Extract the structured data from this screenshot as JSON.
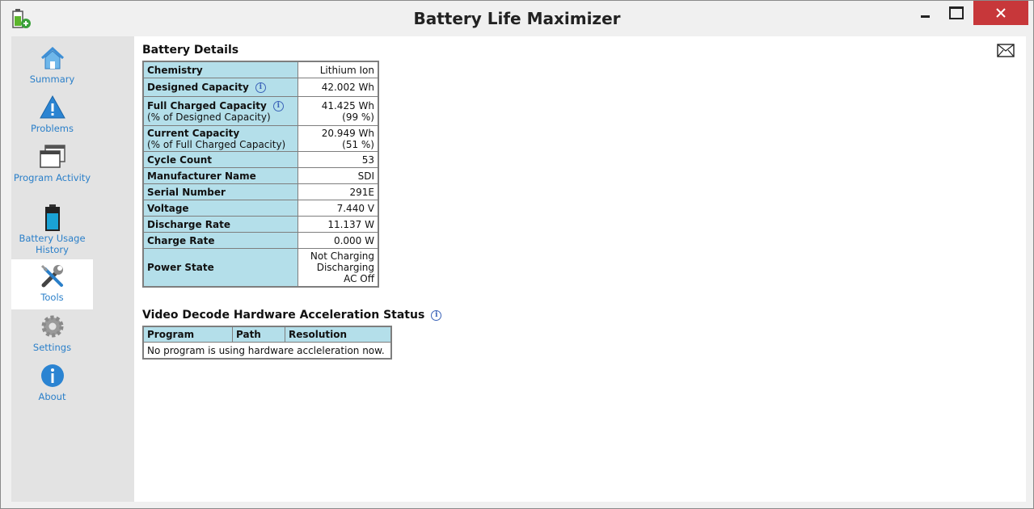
{
  "window": {
    "title": "Battery Life Maximizer"
  },
  "nav": [
    {
      "label": "Summary",
      "icon": "home-icon"
    },
    {
      "label": "Problems",
      "icon": "warning-icon"
    },
    {
      "label": "Program Activity",
      "icon": "windows-icon"
    },
    {
      "label": "Battery Usage History",
      "icon": "battery-icon"
    },
    {
      "label": "Tools",
      "icon": "tools-icon",
      "active": true
    },
    {
      "label": "Settings",
      "icon": "gear-icon"
    },
    {
      "label": "About",
      "icon": "info-icon"
    }
  ],
  "battery": {
    "heading": "Battery Details",
    "rows": [
      {
        "label": "Chemistry",
        "value": "Lithium Ion"
      },
      {
        "label": "Designed Capacity",
        "value": "42.002 Wh",
        "info": true
      },
      {
        "label": "Full Charged Capacity",
        "sub": "(% of Designed Capacity)",
        "value": "41.425 Wh",
        "value2": "(99 %)",
        "info": true
      },
      {
        "label": "Current Capacity",
        "sub": "(% of Full Charged Capacity)",
        "value": "20.949 Wh",
        "value2": "(51 %)"
      },
      {
        "label": "Cycle Count",
        "value": "53"
      },
      {
        "label": "Manufacturer Name",
        "value": "SDI"
      },
      {
        "label": "Serial Number",
        "value": "291E"
      },
      {
        "label": "Voltage",
        "value": "7.440 V"
      },
      {
        "label": "Discharge Rate",
        "value": "11.137 W"
      },
      {
        "label": "Charge Rate",
        "value": "0.000 W"
      },
      {
        "label": "Power State",
        "value": "Not Charging",
        "value2": "Discharging",
        "value3": "AC Off"
      }
    ]
  },
  "video": {
    "heading": "Video Decode Hardware Acceleration Status",
    "columns": [
      "Program",
      "Path",
      "Resolution"
    ],
    "empty_message": "No program is using hardware accleleration now."
  },
  "info_glyph": "i"
}
